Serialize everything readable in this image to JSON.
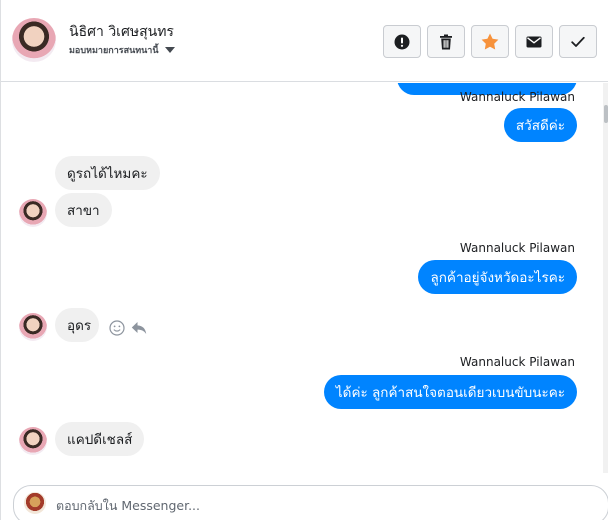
{
  "header": {
    "contact_name": "นิธิศา วิเศษสุนทร",
    "contact_subtitle": "มอบหมายการสนทนานี้",
    "actions": [
      {
        "name": "mark-spam",
        "icon": "alert-circle-icon"
      },
      {
        "name": "delete",
        "icon": "trash-icon"
      },
      {
        "name": "star",
        "icon": "star-icon",
        "color": "#f7923b"
      },
      {
        "name": "mark-unread",
        "icon": "envelope-icon"
      },
      {
        "name": "mark-done",
        "icon": "check-icon"
      }
    ]
  },
  "messages": [
    {
      "direction": "out",
      "text": "",
      "partial": true
    },
    {
      "direction": "out",
      "sender": "Wannaluck Pilawan",
      "text": "สวัสดีค่ะ"
    },
    {
      "direction": "in",
      "text": "ดูรถได้ไหมคะ"
    },
    {
      "direction": "in",
      "text": "สาขา"
    },
    {
      "direction": "out",
      "sender": "Wannaluck Pilawan",
      "text": "ลูกค้าอยู่จังหวัดอะไรคะ"
    },
    {
      "direction": "in",
      "text": "อุดร"
    },
    {
      "direction": "out",
      "sender": "Wannaluck Pilawan",
      "text": "ได้ค่ะ ลูกค้าสนใจตอนเดียวเบนขับนะคะ"
    },
    {
      "direction": "in",
      "text": "แคปดีเชลส์"
    }
  ],
  "composer": {
    "placeholder": "ตอบกลับใน Messenger..."
  },
  "colors": {
    "accent": "#0084ff",
    "incoming_bubble": "#f0f0f0",
    "star": "#f7923b"
  }
}
